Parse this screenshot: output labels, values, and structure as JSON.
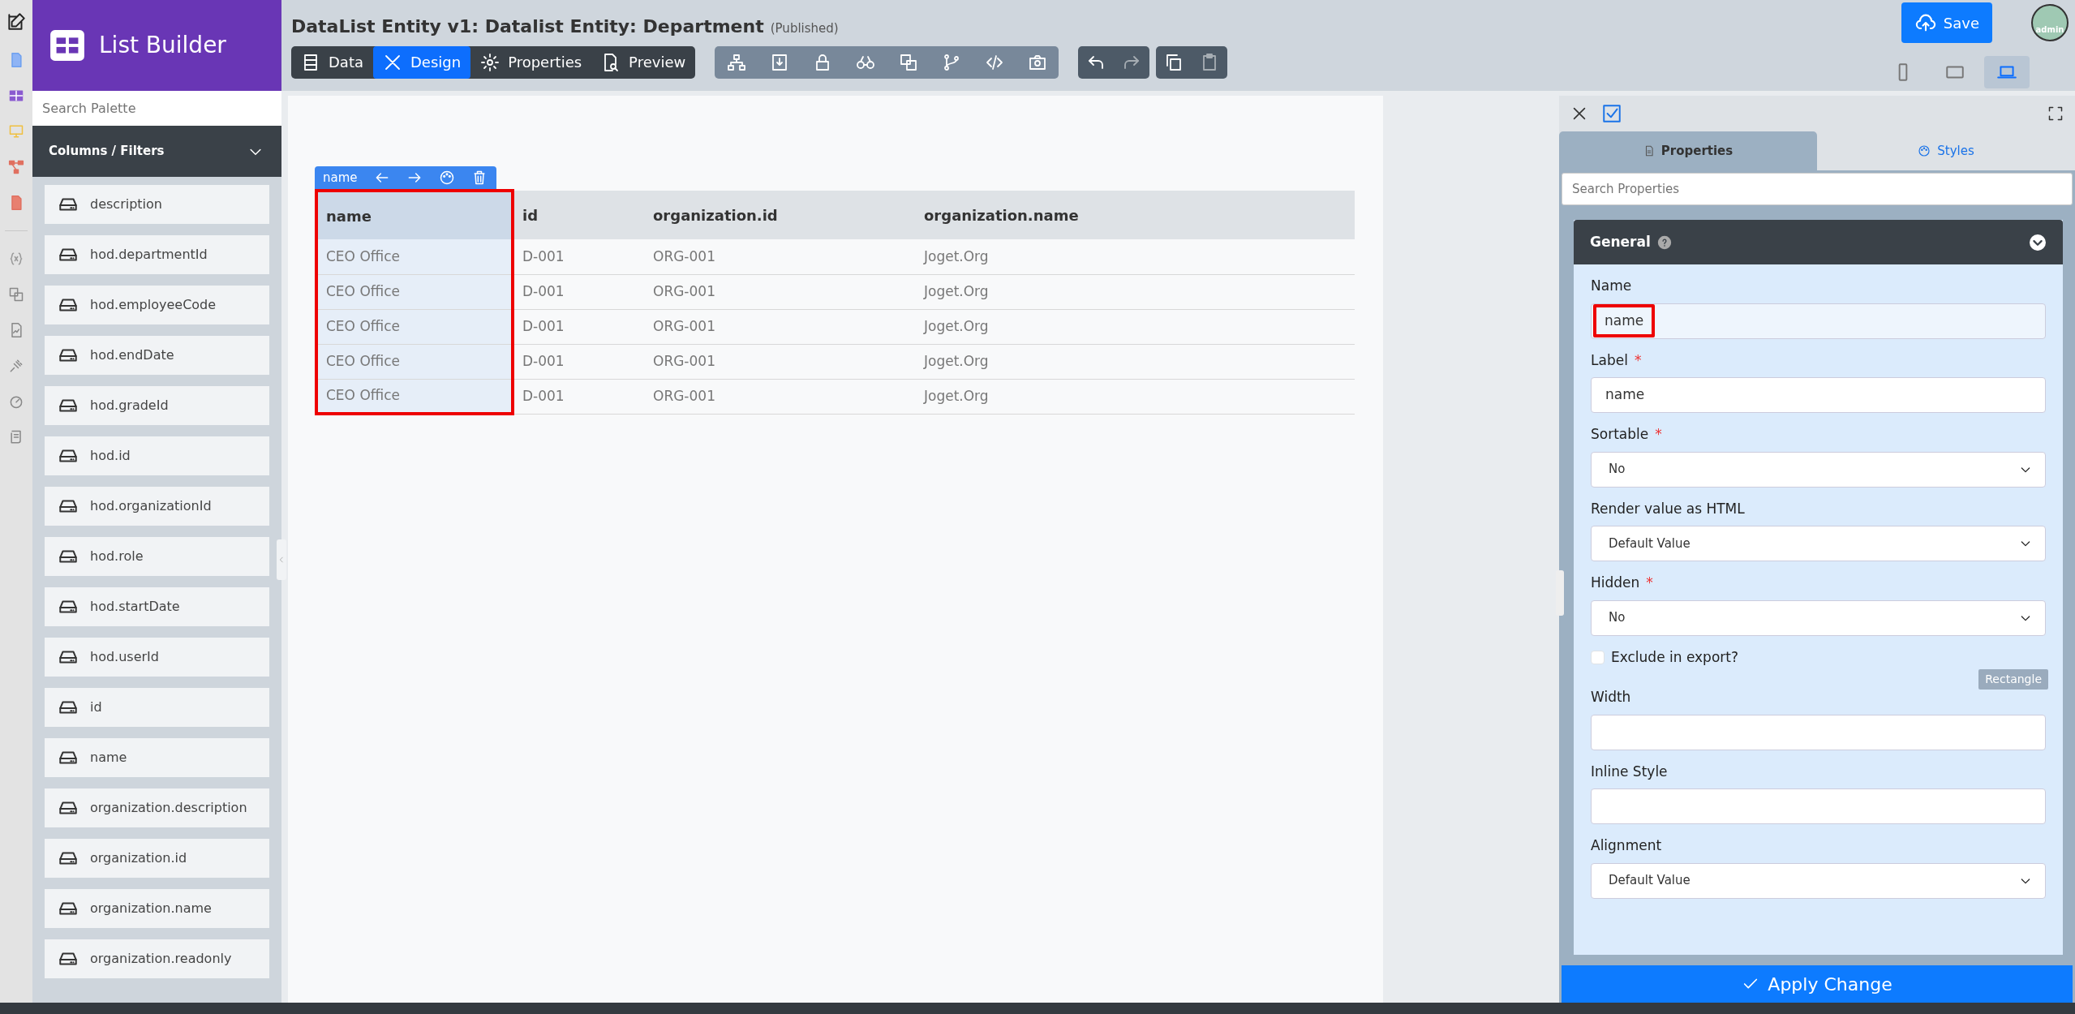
{
  "sidebar": {
    "title": "List Builder",
    "search": {
      "placeholder": "Search Palette"
    },
    "section": {
      "title": "Columns / Filters",
      "expanded": true
    },
    "items": [
      "description",
      "hod.departmentId",
      "hod.employeeCode",
      "hod.endDate",
      "hod.gradeId",
      "hod.id",
      "hod.organizationId",
      "hod.role",
      "hod.startDate",
      "hod.userId",
      "id",
      "name",
      "organization.description",
      "organization.id",
      "organization.name",
      "organization.readonly"
    ]
  },
  "header": {
    "title": "DataList Entity v1: Datalist Entity: Department",
    "status": "(Published)",
    "save": "Save",
    "avatar": "admin"
  },
  "mode_tabs": [
    {
      "kind": "data",
      "label": "Data",
      "selected": false
    },
    {
      "kind": "design",
      "label": "Design",
      "selected": true
    },
    {
      "kind": "properties",
      "label": "Properties",
      "selected": false
    },
    {
      "kind": "preview",
      "label": "Preview",
      "selected": false
    }
  ],
  "history_tools": [
    {
      "kind": "undo",
      "disabled": false
    },
    {
      "kind": "redo",
      "disabled": true
    }
  ],
  "clipboard_tools": [
    {
      "kind": "copy",
      "disabled": false
    },
    {
      "kind": "paste",
      "disabled": true
    }
  ],
  "devices": [
    {
      "kind": "phone",
      "selected": false
    },
    {
      "kind": "tablet",
      "selected": false
    },
    {
      "kind": "laptop",
      "selected": true
    }
  ],
  "column_toolbar": {
    "label": "name"
  },
  "table": {
    "columns": [
      {
        "label": "name",
        "selected": true,
        "highlighted": true
      },
      {
        "label": "id",
        "selected": false
      },
      {
        "label": "organization.id",
        "selected": false
      },
      {
        "label": "organization.name",
        "selected": false
      }
    ],
    "rows": [
      [
        "CEO Office",
        "D-001",
        "ORG-001",
        "Joget.Org"
      ],
      [
        "CEO Office",
        "D-001",
        "ORG-001",
        "Joget.Org"
      ],
      [
        "CEO Office",
        "D-001",
        "ORG-001",
        "Joget.Org"
      ],
      [
        "CEO Office",
        "D-001",
        "ORG-001",
        "Joget.Org"
      ],
      [
        "CEO Office",
        "D-001",
        "ORG-001",
        "Joget.Org"
      ]
    ]
  },
  "panel": {
    "tabs": [
      {
        "kind": "properties",
        "label": "Properties",
        "selected": true
      },
      {
        "kind": "styles",
        "label": "Styles",
        "selected": false
      }
    ],
    "search": {
      "placeholder": "Search Properties"
    },
    "section": {
      "title": "General",
      "expanded": true
    },
    "fields": [
      {
        "kind": "text",
        "label": "Name",
        "value": "name",
        "readonly": true,
        "highlighted": true
      },
      {
        "kind": "text",
        "label": "Label",
        "required_mark": "*",
        "value": "name",
        "readonly": false
      },
      {
        "kind": "select",
        "label": "Sortable",
        "required_mark": "*",
        "value": "No"
      },
      {
        "kind": "select",
        "label": "Render value as HTML",
        "value": "Default Value"
      },
      {
        "kind": "select",
        "label": "Hidden",
        "required_mark": "*",
        "value": "No"
      },
      {
        "kind": "checkbox",
        "label": "Exclude in export?",
        "checked": false
      },
      {
        "kind": "text",
        "label": "Width",
        "readonly": false
      },
      {
        "kind": "text",
        "label": "Inline Style",
        "readonly": false
      },
      {
        "kind": "select",
        "label": "Alignment",
        "value": "Default Value"
      }
    ],
    "apply": "Apply Change"
  },
  "tooltip": "Rectangle"
}
